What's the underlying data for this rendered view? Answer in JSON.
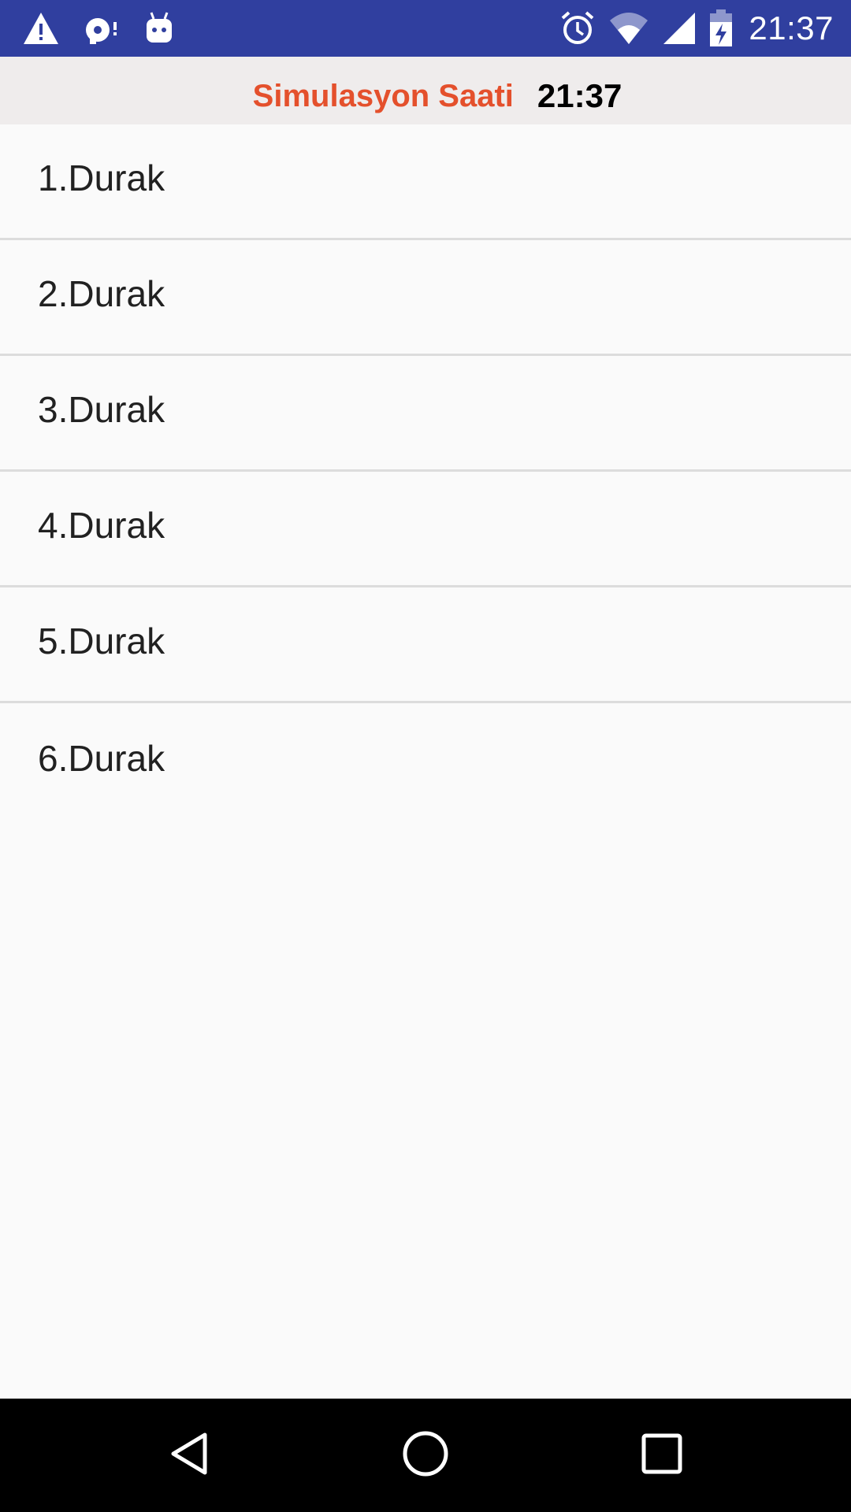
{
  "status_bar": {
    "time": "21:37",
    "left_icons": [
      "warning-icon",
      "sd-card-icon",
      "android-debug-icon"
    ],
    "right_icons": [
      "alarm-icon",
      "wifi-icon",
      "cell-signal-icon",
      "battery-charging-icon"
    ],
    "background": "#303f9f"
  },
  "header": {
    "label": "Simulasyon Saati",
    "time": "21:37",
    "label_color": "#e4502c"
  },
  "stops": [
    {
      "label": "1.Durak"
    },
    {
      "label": "2.Durak"
    },
    {
      "label": "3.Durak"
    },
    {
      "label": "4.Durak"
    },
    {
      "label": "5.Durak"
    },
    {
      "label": "6.Durak"
    }
  ],
  "nav_bar": {
    "buttons": [
      "back-icon",
      "home-icon",
      "recents-icon"
    ]
  }
}
